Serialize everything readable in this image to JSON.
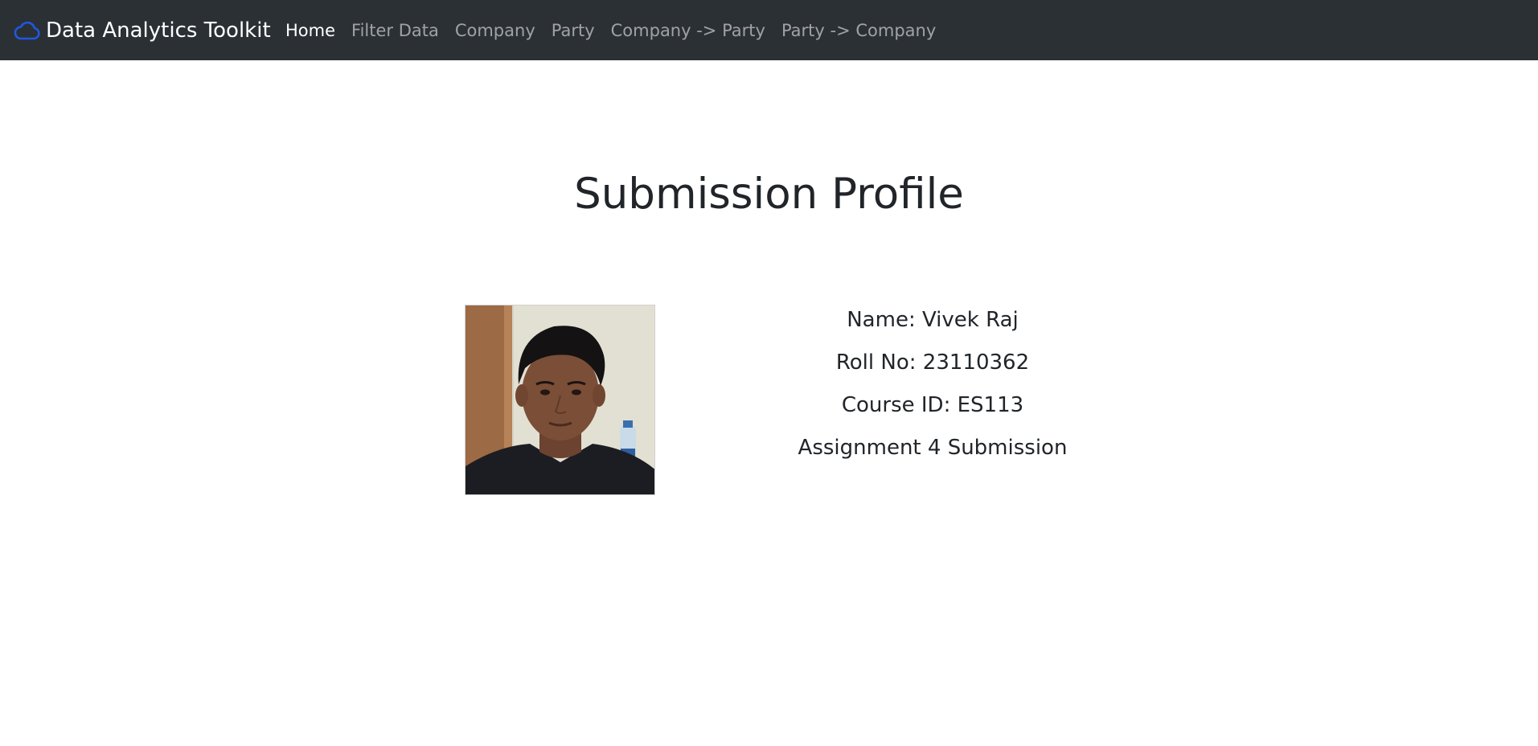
{
  "navbar": {
    "brand": "Data Analytics Toolkit",
    "brand_icon": "cloud-icon",
    "brand_icon_color": "#1f57e0",
    "background_color": "#2b3035",
    "links": [
      {
        "label": "Home",
        "active": true
      },
      {
        "label": "Filter Data",
        "active": false
      },
      {
        "label": "Company",
        "active": false
      },
      {
        "label": "Party",
        "active": false
      },
      {
        "label": "Company -> Party",
        "active": false
      },
      {
        "label": "Party -> Company",
        "active": false
      }
    ]
  },
  "main": {
    "title": "Submission Profile",
    "profile_photo": "profile-photo",
    "details": [
      "Name: Vivek Raj",
      "Roll No: 23110362",
      "Course ID: ES113",
      "Assignment 4 Submission"
    ]
  }
}
